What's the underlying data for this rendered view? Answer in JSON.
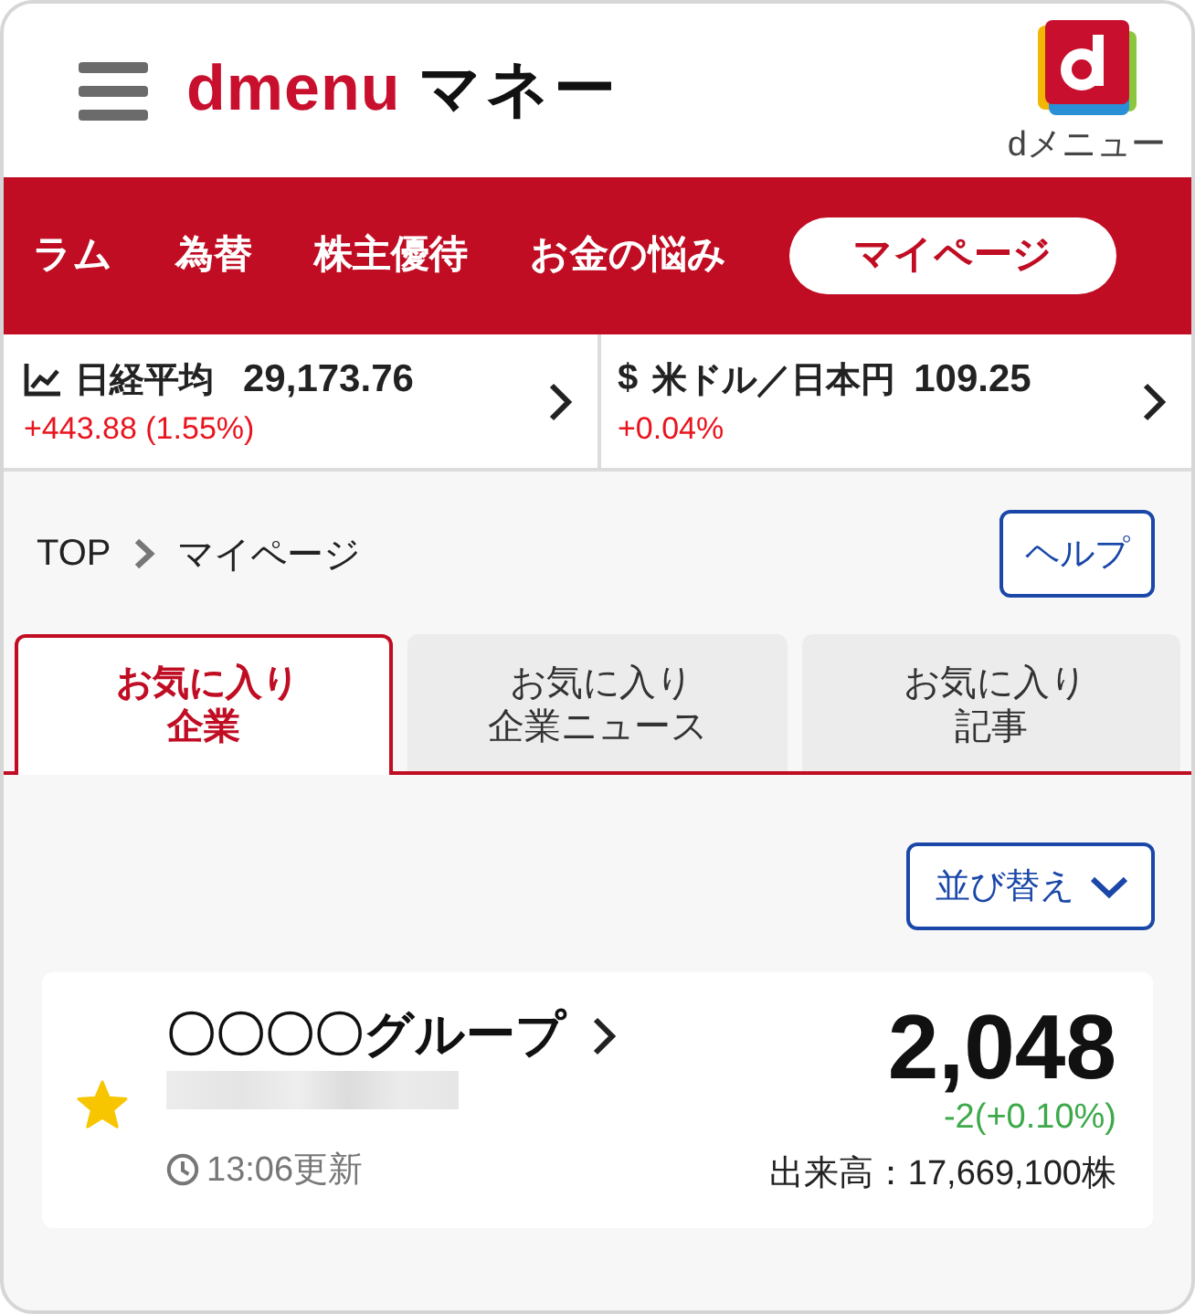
{
  "header": {
    "brand": "dmenu",
    "title": "マネー",
    "app_link": {
      "label": "dメニュー"
    }
  },
  "nav": [
    {
      "label": "ラム",
      "selected": false
    },
    {
      "label": "為替",
      "selected": false
    },
    {
      "label": "株主優待",
      "selected": false
    },
    {
      "label": "お金の悩み",
      "selected": false
    },
    {
      "label": "マイページ",
      "selected": true
    }
  ],
  "tickers": [
    {
      "kind": "index",
      "name": "日経平均",
      "value": "29,173.76",
      "change": "+443.88 (1.55%)"
    },
    {
      "kind": "currency",
      "symbol": "$",
      "name": "米ドル／日本円",
      "value": "109.25",
      "change": "+0.04%"
    }
  ],
  "breadcrumb": [
    "TOP",
    "マイページ"
  ],
  "help_button": "ヘルプ",
  "tabs": [
    {
      "label": "お気に入り企業",
      "selected": true
    },
    {
      "label": "お気に入り企業ニュース",
      "selected": false
    },
    {
      "label": "お気に入り記事",
      "selected": false
    }
  ],
  "sort_button": "並び替え",
  "favorites": [
    {
      "name": "〇〇〇〇グループ",
      "starred": true,
      "code_redacted": true,
      "updated": "13:06更新",
      "price": "2,048",
      "change": "-2(+0.10%)",
      "volume": "出来高：17,669,100株"
    }
  ]
}
